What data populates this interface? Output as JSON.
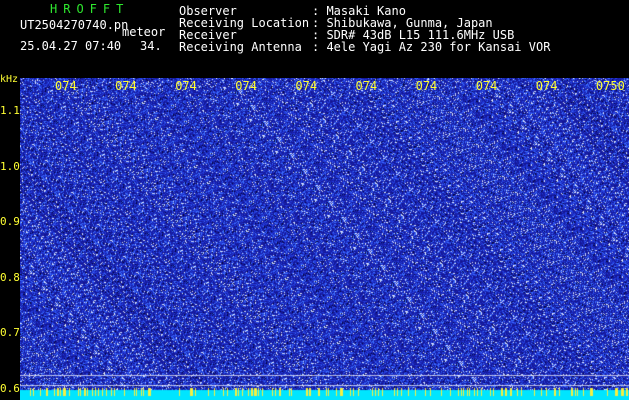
{
  "header": {
    "brand": "HROFFT",
    "filename": "UT2504270740.pn",
    "type_label": "meteor",
    "datetime": "25.04.27 07:40",
    "count": "34.",
    "fields": [
      {
        "label": "Observer",
        "value": ": Masaki Kano"
      },
      {
        "label": "Receiving Location",
        "value": ": Shibukawa, Gunma, Japan"
      },
      {
        "label": "Receiver",
        "value": ": SDR# 43dB L15 111.6MHz USB"
      },
      {
        "label": "Receiving Antenna",
        "value": ": 4ele Yagi Az 230 for Kansai VOR"
      }
    ]
  },
  "chart_data": {
    "type": "heatmap",
    "ylabel": "kHz",
    "x_ticks": [
      "074",
      "074",
      "074",
      "074",
      "074",
      "074",
      "074",
      "074",
      "074",
      "0750"
    ],
    "y_ticks": [
      "1.1",
      "1.0",
      "0.9",
      "0.8",
      "0.7",
      "0.6"
    ],
    "ylim": [
      0.58,
      1.16
    ],
    "colors": {
      "background": "#1a1aa8",
      "noise_low": "#2f4fff",
      "noise_high": "#e8f0ff",
      "baseband": "#00e5ff",
      "grid_line": "#ffffff",
      "tick": "#ffff33"
    }
  }
}
